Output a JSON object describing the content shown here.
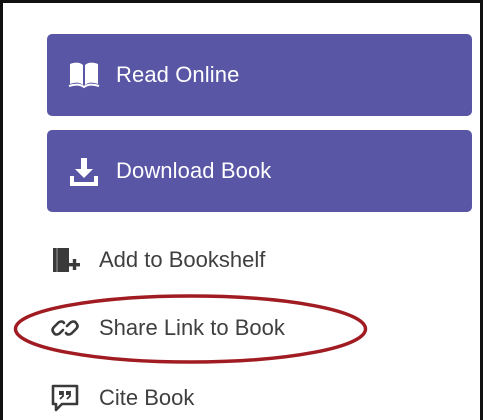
{
  "actions": {
    "read_online_label": "Read Online",
    "download_book_label": "Download Book"
  },
  "links": {
    "add_to_bookshelf_label": "Add to Bookshelf",
    "share_link_label": "Share Link to Book",
    "cite_book_label": "Cite Book"
  },
  "icons": {
    "read_online": "open-book-icon",
    "download_book": "download-icon",
    "add_to_bookshelf": "add-to-shelf-icon",
    "share_link": "link-icon",
    "cite_book": "quote-bubble-icon"
  },
  "colors": {
    "button_bg": "#5856a5",
    "button_text": "#ffffff",
    "link_text": "#3f3f3f",
    "icon_gray": "#3a3a3a",
    "highlight_ring": "#a01c22"
  }
}
